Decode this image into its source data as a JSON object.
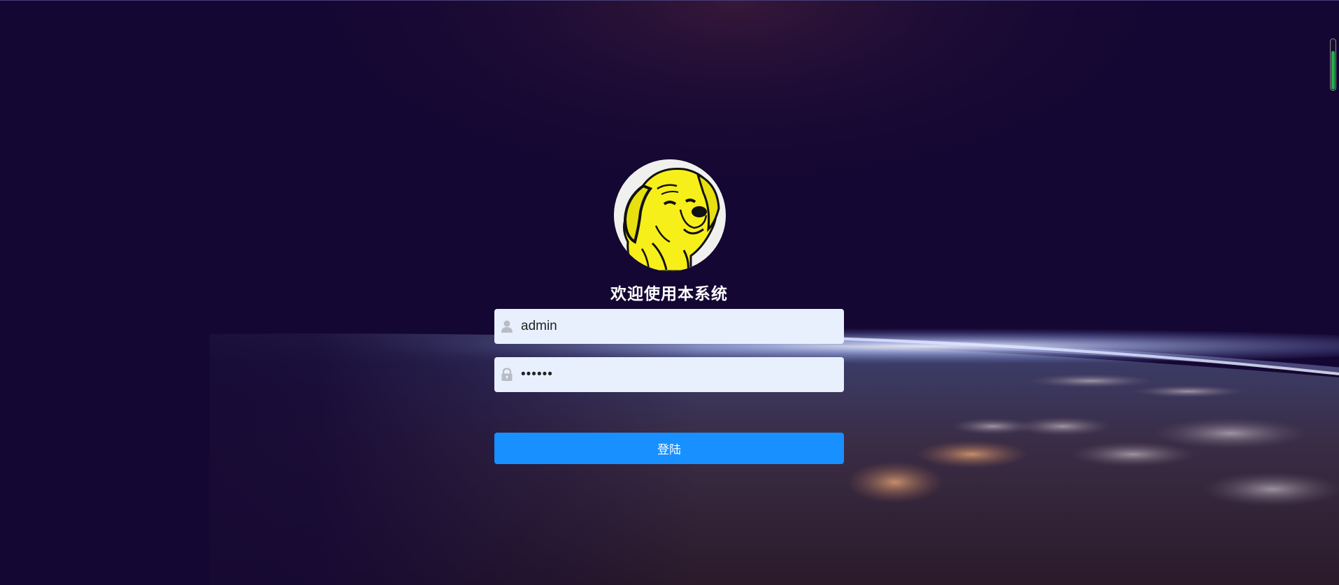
{
  "page": {
    "background_color": "#140733",
    "accent_color": "#1890ff"
  },
  "login": {
    "avatar_icon": "golden-retriever-logo",
    "welcome_title": "欢迎使用本系统",
    "username": {
      "icon": "user-icon",
      "value": "admin"
    },
    "password": {
      "icon": "lock-icon",
      "value": "••••••"
    },
    "submit_label": "登陆"
  },
  "scroll_indicator": {
    "level": 0.75,
    "color": "#22b14c"
  }
}
